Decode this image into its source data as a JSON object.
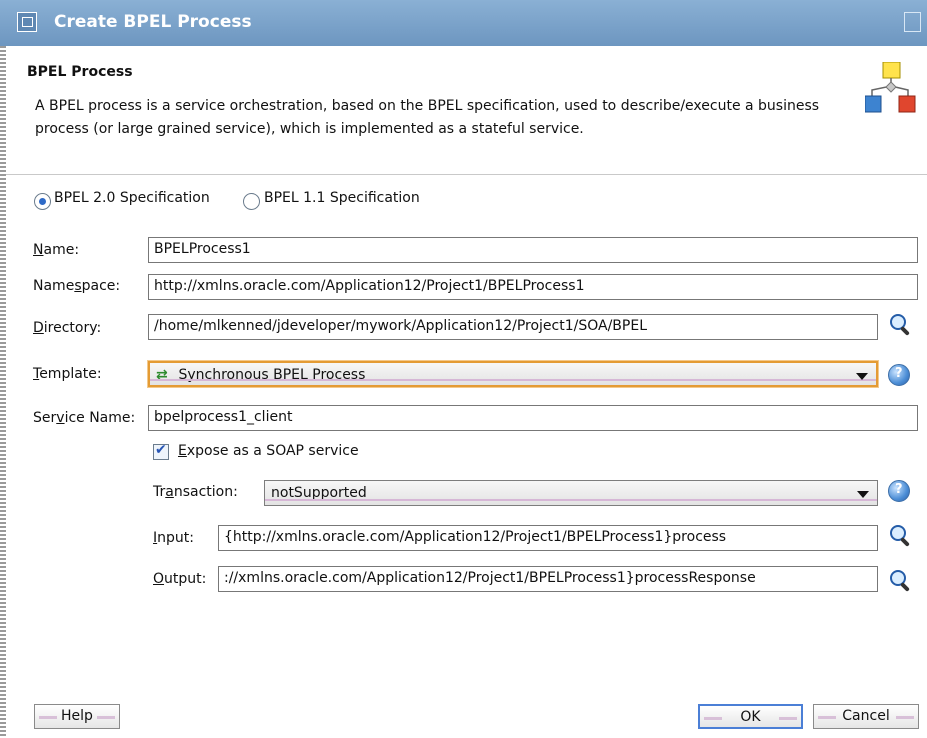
{
  "window": {
    "title": "Create BPEL Process"
  },
  "header": {
    "heading": "BPEL Process",
    "description": "A BPEL process is a service orchestration, based on the BPEL specification, used to describe/execute a business process (or large grained service), which is implemented as a stateful service."
  },
  "spec": {
    "option_20": "BPEL 2.0 Specification",
    "option_11": "BPEL 1.1 Specification",
    "selected": "BPEL 2.0 Specification"
  },
  "form": {
    "name_label": "Name:",
    "name_value": "BPELProcess1",
    "namespace_label": "Namespace:",
    "namespace_value": "http://xmlns.oracle.com/Application12/Project1/BPELProcess1",
    "directory_label": "Directory:",
    "directory_value": "/home/mlkenned/jdeveloper/mywork/Application12/Project1/SOA/BPEL",
    "template_label": "Template:",
    "template_value": "Synchronous BPEL Process",
    "service_name_label": "Service Name:",
    "service_name_value": "bpelprocess1_client",
    "expose_soap_label": "Expose as a SOAP service",
    "expose_soap_checked": true,
    "transaction_label": "Transaction:",
    "transaction_value": "notSupported",
    "input_label": "Input:",
    "input_value": "{http://xmlns.oracle.com/Application12/Project1/BPELProcess1}process",
    "output_label": "Output:",
    "output_value": "://xmlns.oracle.com/Application12/Project1/BPELProcess1}processResponse"
  },
  "buttons": {
    "help": "Help",
    "ok": "OK",
    "cancel": "Cancel"
  },
  "icons": {
    "window": "window-icon",
    "maximize": "maximize-icon",
    "process": "bpel-process-icon",
    "search": "search-icon",
    "help": "help-icon",
    "template": "swap-arrows-icon"
  },
  "colors": {
    "titlebar": "#6d96c0",
    "focus": "#e49b34",
    "selection": "#2e6ac7"
  }
}
